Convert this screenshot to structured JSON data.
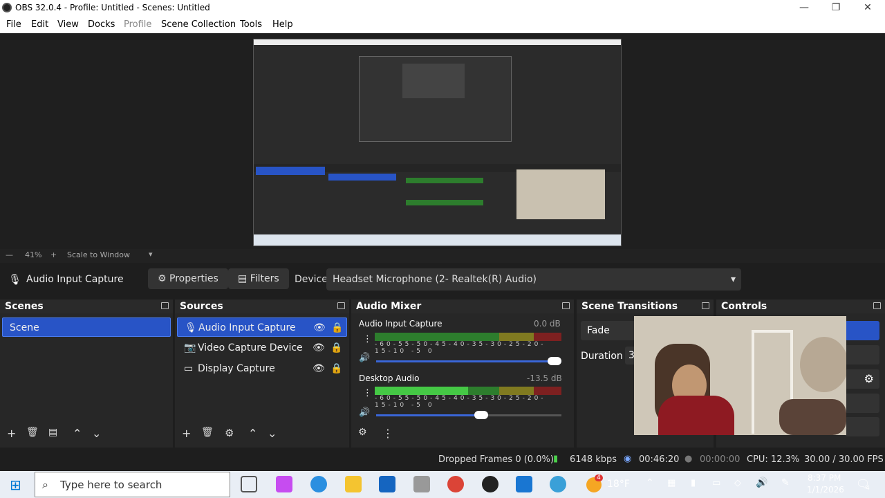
{
  "window": {
    "title": "OBS 32.0.4 - Profile: Untitled - Scenes: Untitled",
    "minimize": "—",
    "maximize": "❐",
    "close": "✕"
  },
  "menu": [
    "File",
    "Edit",
    "View",
    "Docks",
    "Profile",
    "Scene Collection",
    "Tools",
    "Help"
  ],
  "zoom": {
    "value": "41%",
    "minus": "—",
    "plus": "+",
    "scale_label": "Scale to Window"
  },
  "source_toolbar": {
    "source_name": "Audio Input Capture",
    "properties": "Properties",
    "filters": "Filters",
    "device_label": "Device",
    "device_value": "Headset Microphone (2- Realtek(R) Audio)"
  },
  "scenes": {
    "title": "Scenes",
    "items": [
      "Scene"
    ]
  },
  "sources": {
    "title": "Sources",
    "items": [
      "Audio Input Capture",
      "Video Capture Device",
      "Display Capture"
    ]
  },
  "mixer": {
    "title": "Audio Mixer",
    "channels": [
      {
        "name": "Audio Input Capture",
        "db": "0.0 dB",
        "level": 0.0,
        "volume": 1.0
      },
      {
        "name": "Desktop Audio",
        "db": "-13.5 dB",
        "level": 0.5,
        "volume": 0.58
      }
    ],
    "scale": [
      "-60",
      "-55",
      "-50",
      "-45",
      "-40",
      "-35",
      "-30",
      "-25",
      "-20",
      "-15",
      "-10",
      "-5",
      "0"
    ]
  },
  "transitions": {
    "title": "Scene Transitions",
    "transition": "Fade",
    "duration_label": "Duration",
    "duration_value": "3"
  },
  "controls": {
    "title": "Controls"
  },
  "status": {
    "dropped": "Dropped Frames 0 (0.0%)",
    "bitrate": "6148 kbps",
    "stream_time": "00:46:20",
    "rec_time": "00:00:00",
    "cpu": "CPU: 12.3%",
    "fps": "30.00 / 30.00 FPS"
  },
  "taskbar": {
    "search_placeholder": "Type here to search",
    "weather": "18°F",
    "weather_badge": "4",
    "time": "8:37 PM",
    "date": "1/1/2026",
    "notification_badge": "4"
  },
  "colors": {
    "accent": "#2854c6",
    "bg": "#1e1e1e",
    "dock": "#272727"
  }
}
